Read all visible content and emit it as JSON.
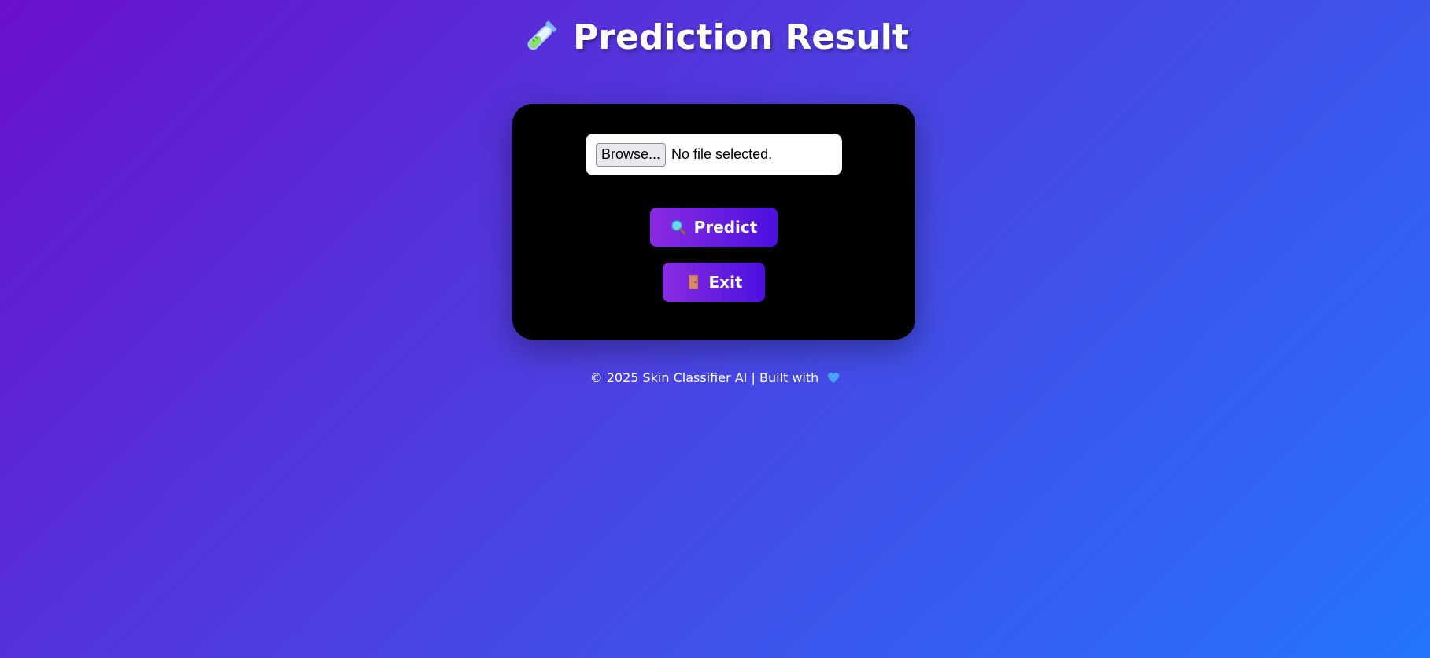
{
  "header": {
    "title": "Prediction Result",
    "icon": "test-tube-icon"
  },
  "form": {
    "browse_label": "Browse...",
    "file_status": "No file selected.",
    "predict_label": "Predict",
    "predict_icon": "magnifier-icon",
    "exit_label": "Exit",
    "exit_icon": "door-icon"
  },
  "footer": {
    "text": "© 2025 Skin Classifier AI | Built with",
    "icon": "blue-heart-icon"
  },
  "colors": {
    "background_start": "#6a11cb",
    "background_end": "#2575fc",
    "card": "#000000",
    "button_start": "#8a2be2",
    "button_end": "#4a10e0",
    "heart": "#4aa3ff"
  }
}
